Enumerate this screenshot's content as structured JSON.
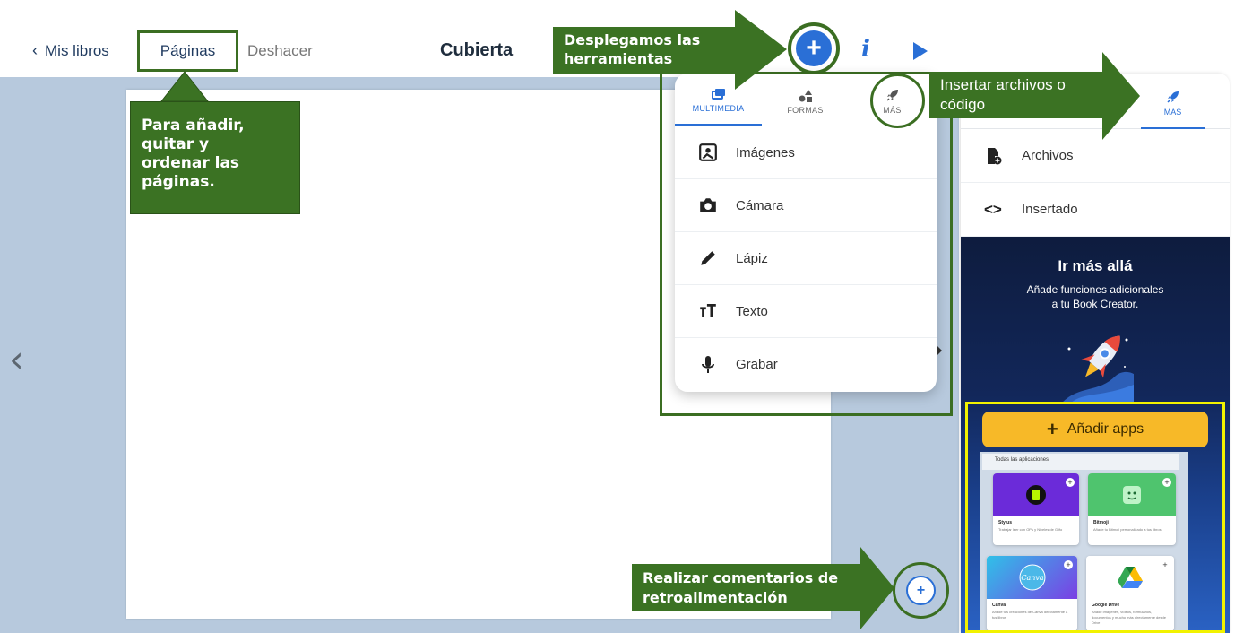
{
  "header": {
    "back_label": "Mis libros",
    "pages_label": "Páginas",
    "undo_label": "Deshacer",
    "book_title": "Cubierta",
    "add_symbol": "+",
    "info_symbol": "i"
  },
  "tools_menu": {
    "tabs": [
      {
        "label": "MULTIMEDIA",
        "icon": "media-icon",
        "active": true
      },
      {
        "label": "FORMAS",
        "icon": "shapes-icon",
        "active": false
      },
      {
        "label": "MÁS",
        "icon": "rocket-icon",
        "active": false
      }
    ],
    "items": [
      {
        "label": "Imágenes",
        "icon": "image-icon"
      },
      {
        "label": "Cámara",
        "icon": "camera-icon"
      },
      {
        "label": "Lápiz",
        "icon": "pencil-icon"
      },
      {
        "label": "Texto",
        "icon": "text-icon"
      },
      {
        "label": "Grabar",
        "icon": "microphone-icon"
      }
    ]
  },
  "right_panel": {
    "tab_label": "MÁS",
    "items": [
      {
        "label": "Archivos",
        "icon": "file-add-icon"
      },
      {
        "label": "Insertado",
        "icon": "code-icon"
      }
    ],
    "promo_title": "Ir más allá",
    "promo_sub_1": "Añade funciones adicionales",
    "promo_sub_2": "a tu Book Creator.",
    "add_apps_label": "Añadir apps",
    "apps_heading": "Todas las aplicaciones",
    "apps": [
      {
        "name": "Stylus",
        "desc": "Trabajar leer con OPs y Niveles de Glifo",
        "color": "#6b2bd9",
        "icon": "doc-app-icon"
      },
      {
        "name": "Bitmoji",
        "desc": "Añade tu Bitmoji personalizado a tus libros",
        "color": "#4fc46e",
        "icon": "bitmoji-icon"
      },
      {
        "name": "Canva",
        "desc": "Añade tus creaciones de Canva directamente a tus libros",
        "color": "#4f9fe0",
        "icon": "canva-icon"
      },
      {
        "name": "Google Drive",
        "desc": "Añade imágenes, vídeos, formularios, documentos y mucho más directamente desde Drive",
        "color": "#ffffff",
        "icon": "google-drive-icon"
      }
    ]
  },
  "annotations": {
    "pages_note_lines": [
      "Para añadir,",
      "quitar y",
      "ordenar las",
      "páginas."
    ],
    "deploy_note_lines": [
      "Desplegamos las",
      "herramientas"
    ],
    "insert_note_lines": [
      "Insertar archivos o",
      "código"
    ],
    "feedback_note_lines": [
      "Realizar comentarios de",
      "retroalimentación"
    ]
  },
  "colors": {
    "annotation_green": "#3b7223",
    "accent_blue": "#2a6fd6",
    "add_apps_yellow": "#f7b928",
    "highlight_yellow": "#f2f200",
    "stage_bg": "#b7c9dd"
  }
}
